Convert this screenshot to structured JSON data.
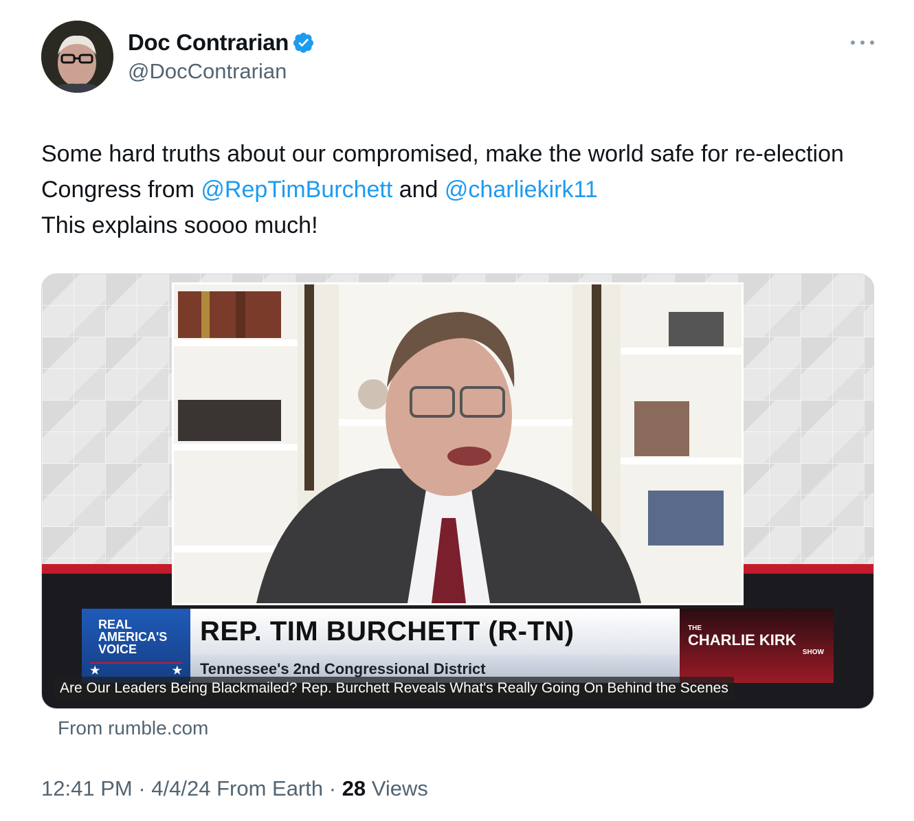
{
  "author": {
    "display_name": "Doc Contrarian",
    "handle": "@DocContrarian",
    "verified": true,
    "avatar_icon": "profile-photo"
  },
  "tweet": {
    "text_part1": "Some hard truths about our compromised, make the world safe for re-election Congress from ",
    "mention1": "@RepTimBurchett",
    "text_part2": " and ",
    "mention2": "@charliekirk11",
    "text_part3": "This explains soooo much!"
  },
  "card": {
    "lower_third": {
      "network_logo": "REAL AMERICA'S VOICE",
      "headline": "REP. TIM BURCHETT (R-TN)",
      "subheadline": "Tennessee's 2nd Congressional District",
      "show_the": "THE",
      "show_name": "CHARLIE KIRK",
      "show_word": "SHOW"
    },
    "video_title": "Are Our Leaders Being Blackmailed? Rep. Burchett Reveals What's Really Going On Behind the Scenes",
    "source": "From rumble.com"
  },
  "meta": {
    "time": "12:41 PM",
    "sep1": " · ",
    "date": "4/4/24",
    "from": " From Earth",
    "sep2": " · ",
    "views_count": "28",
    "views_label": " Views"
  },
  "colors": {
    "accent": "#1d9bf0",
    "text": "#0f1419",
    "secondary": "#536471"
  }
}
